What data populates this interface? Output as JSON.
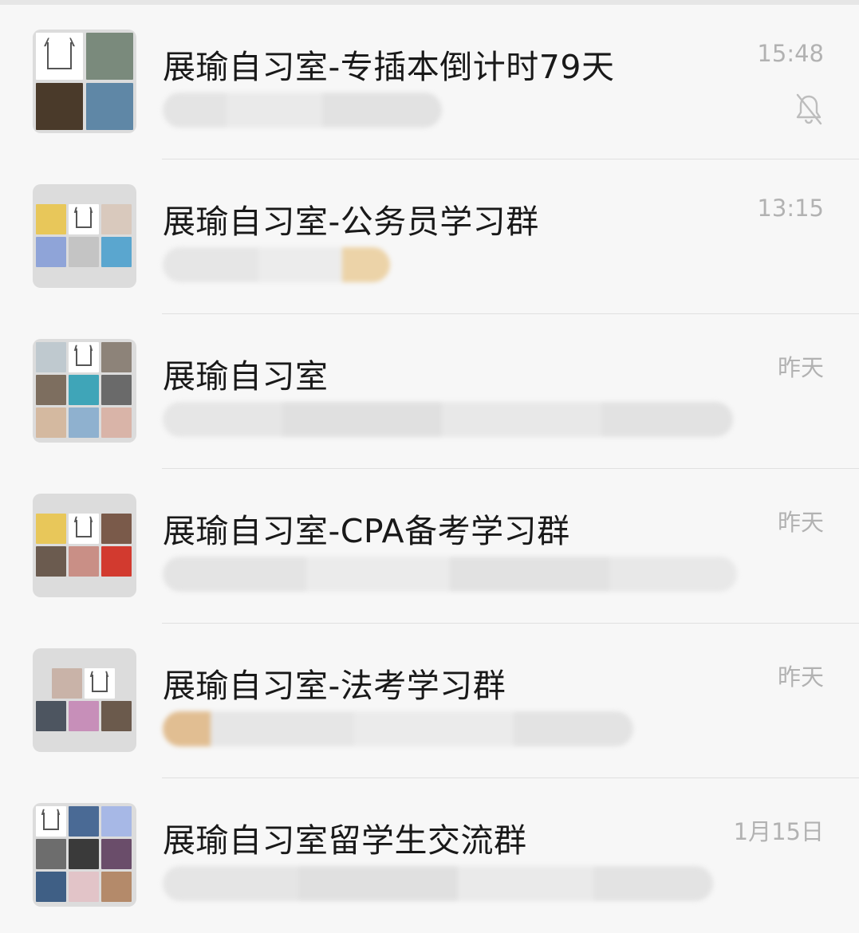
{
  "chats": [
    {
      "title": "展瑜自习室-专插本倒计时79天",
      "time": "15:48",
      "muted": true,
      "avatar_layout": "2x2",
      "avatar_tiles": [
        "logo",
        "#7a8a7c",
        "#4a3a2a",
        "#5f87a6"
      ]
    },
    {
      "title": "展瑜自习室-公务员学习群",
      "time": "13:15",
      "muted": false,
      "avatar_layout": "3x2",
      "avatar_tiles": [
        "#e8c75a",
        "logo",
        "#d9c9bd",
        "#8fa4d8",
        "#c4c4c4",
        "#5aa6cf"
      ]
    },
    {
      "title": "展瑜自习室",
      "time": "昨天",
      "muted": false,
      "avatar_layout": "3x3",
      "avatar_tiles": [
        "#bfc9cf",
        "logo",
        "#8d8379",
        "#7d6e5f",
        "#3fa5b8",
        "#6a6a6a",
        "#d4b9a0",
        "#8fb1cf",
        "#d9b4a8"
      ]
    },
    {
      "title": "展瑜自习室-CPA备考学习群",
      "time": "昨天",
      "muted": false,
      "avatar_layout": "3x2",
      "avatar_tiles": [
        "#e8c75a",
        "logo",
        "#7a5a4a",
        "#6b5b4f",
        "#c98f86",
        "#d23a2f"
      ]
    },
    {
      "title": "展瑜自习室-法考学习群",
      "time": "昨天",
      "muted": false,
      "avatar_layout": "2+3",
      "avatar_tiles": [
        "#c9b3a8",
        "logo",
        "#4d5560",
        "#c78fb9",
        "#6b5a4c"
      ]
    },
    {
      "title": "展瑜自习室留学生交流群",
      "time": "1月15日",
      "muted": false,
      "avatar_layout": "3x3",
      "avatar_tiles": [
        "logo",
        "#4a6a95",
        "#a7b8e6",
        "#6d6d6d",
        "#3a3a3a",
        "#6a4d6a",
        "#3f5f85",
        "#e2c4c8",
        "#b48a6a"
      ]
    }
  ],
  "colors": {
    "title": "#191919",
    "time": "#b2b2b2",
    "background": "#f7f7f7",
    "divider": "#e0e0e0"
  },
  "icons": {
    "mute": "bell-off-icon"
  }
}
